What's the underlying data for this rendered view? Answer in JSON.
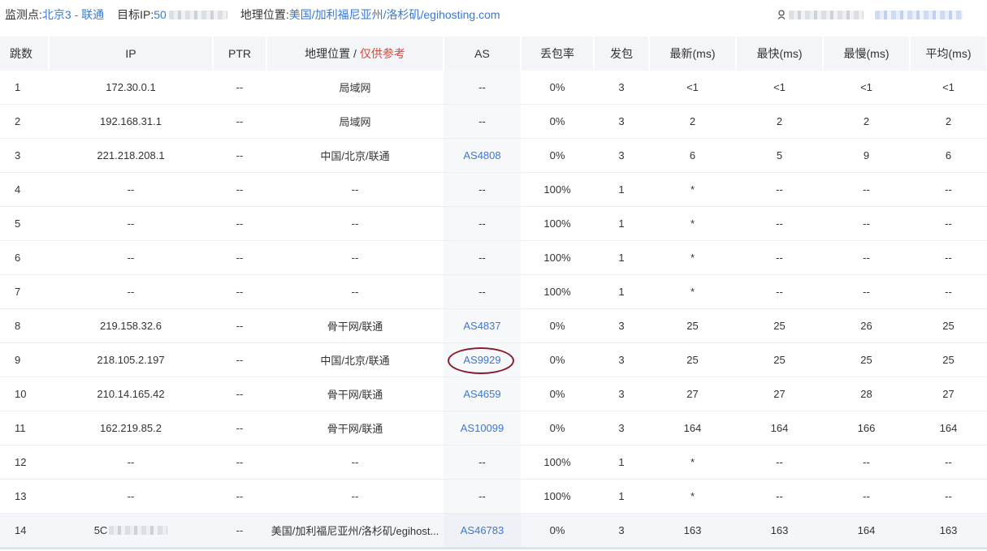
{
  "header": {
    "monitor_label": "监测点:",
    "monitor_value": "北京3 - 联通",
    "target_label": "目标IP:",
    "target_value_visible": "50",
    "location_label": "地理位置:",
    "location_value": "美国/加利福尼亚州/洛杉矶/egihosting.com"
  },
  "table": {
    "columns": {
      "hop": "跳数",
      "ip": "IP",
      "ptr": "PTR",
      "geo": "地理位置",
      "geo_sep": " / ",
      "geo_note": "仅供参考",
      "as": "AS",
      "loss": "丢包率",
      "sent": "发包",
      "latest": "最新(ms)",
      "fastest": "最快(ms)",
      "slowest": "最慢(ms)",
      "avg": "平均(ms)"
    },
    "rows": [
      {
        "hop": "1",
        "ip": "172.30.0.1",
        "ptr": "--",
        "geo": "局域网",
        "as": "--",
        "loss": "0%",
        "sent": "3",
        "latest": "<1",
        "fastest": "<1",
        "slowest": "<1",
        "avg": "<1"
      },
      {
        "hop": "2",
        "ip": "192.168.31.1",
        "ptr": "--",
        "geo": "局域网",
        "as": "--",
        "loss": "0%",
        "sent": "3",
        "latest": "2",
        "fastest": "2",
        "slowest": "2",
        "avg": "2"
      },
      {
        "hop": "3",
        "ip": "221.218.208.1",
        "ptr": "--",
        "geo": "中国/北京/联通",
        "as": "AS4808",
        "loss": "0%",
        "sent": "3",
        "latest": "6",
        "fastest": "5",
        "slowest": "9",
        "avg": "6"
      },
      {
        "hop": "4",
        "ip": "--",
        "ptr": "--",
        "geo": "--",
        "as": "--",
        "loss": "100%",
        "sent": "1",
        "latest": "*",
        "fastest": "--",
        "slowest": "--",
        "avg": "--"
      },
      {
        "hop": "5",
        "ip": "--",
        "ptr": "--",
        "geo": "--",
        "as": "--",
        "loss": "100%",
        "sent": "1",
        "latest": "*",
        "fastest": "--",
        "slowest": "--",
        "avg": "--"
      },
      {
        "hop": "6",
        "ip": "--",
        "ptr": "--",
        "geo": "--",
        "as": "--",
        "loss": "100%",
        "sent": "1",
        "latest": "*",
        "fastest": "--",
        "slowest": "--",
        "avg": "--"
      },
      {
        "hop": "7",
        "ip": "--",
        "ptr": "--",
        "geo": "--",
        "as": "--",
        "loss": "100%",
        "sent": "1",
        "latest": "*",
        "fastest": "--",
        "slowest": "--",
        "avg": "--"
      },
      {
        "hop": "8",
        "ip": "219.158.32.6",
        "ptr": "--",
        "geo": "骨干网/联通",
        "as": "AS4837",
        "loss": "0%",
        "sent": "3",
        "latest": "25",
        "fastest": "25",
        "slowest": "26",
        "avg": "25"
      },
      {
        "hop": "9",
        "ip": "218.105.2.197",
        "ptr": "--",
        "geo": "中国/北京/联通",
        "as": "AS9929",
        "loss": "0%",
        "sent": "3",
        "latest": "25",
        "fastest": "25",
        "slowest": "25",
        "avg": "25"
      },
      {
        "hop": "10",
        "ip": "210.14.165.42",
        "ptr": "--",
        "geo": "骨干网/联通",
        "as": "AS4659",
        "loss": "0%",
        "sent": "3",
        "latest": "27",
        "fastest": "27",
        "slowest": "28",
        "avg": "27"
      },
      {
        "hop": "11",
        "ip": "162.219.85.2",
        "ptr": "--",
        "geo": "骨干网/联通",
        "as": "AS10099",
        "loss": "0%",
        "sent": "3",
        "latest": "164",
        "fastest": "164",
        "slowest": "166",
        "avg": "164"
      },
      {
        "hop": "12",
        "ip": "--",
        "ptr": "--",
        "geo": "--",
        "as": "--",
        "loss": "100%",
        "sent": "1",
        "latest": "*",
        "fastest": "--",
        "slowest": "--",
        "avg": "--"
      },
      {
        "hop": "13",
        "ip": "--",
        "ptr": "--",
        "geo": "--",
        "as": "--",
        "loss": "100%",
        "sent": "1",
        "latest": "*",
        "fastest": "--",
        "slowest": "--",
        "avg": "--"
      },
      {
        "hop": "14",
        "ip": "5C",
        "ptr": "--",
        "geo": "美国/加利福尼亚州/洛杉矶/egihost...",
        "as": "AS46783",
        "loss": "0%",
        "sent": "3",
        "latest": "163",
        "fastest": "163",
        "slowest": "164",
        "avg": "163"
      }
    ]
  },
  "colors": {
    "link": "#3a78d4",
    "note": "#e0453a",
    "circle": "#8b1c2c",
    "header_bg": "#f4f5f8"
  }
}
